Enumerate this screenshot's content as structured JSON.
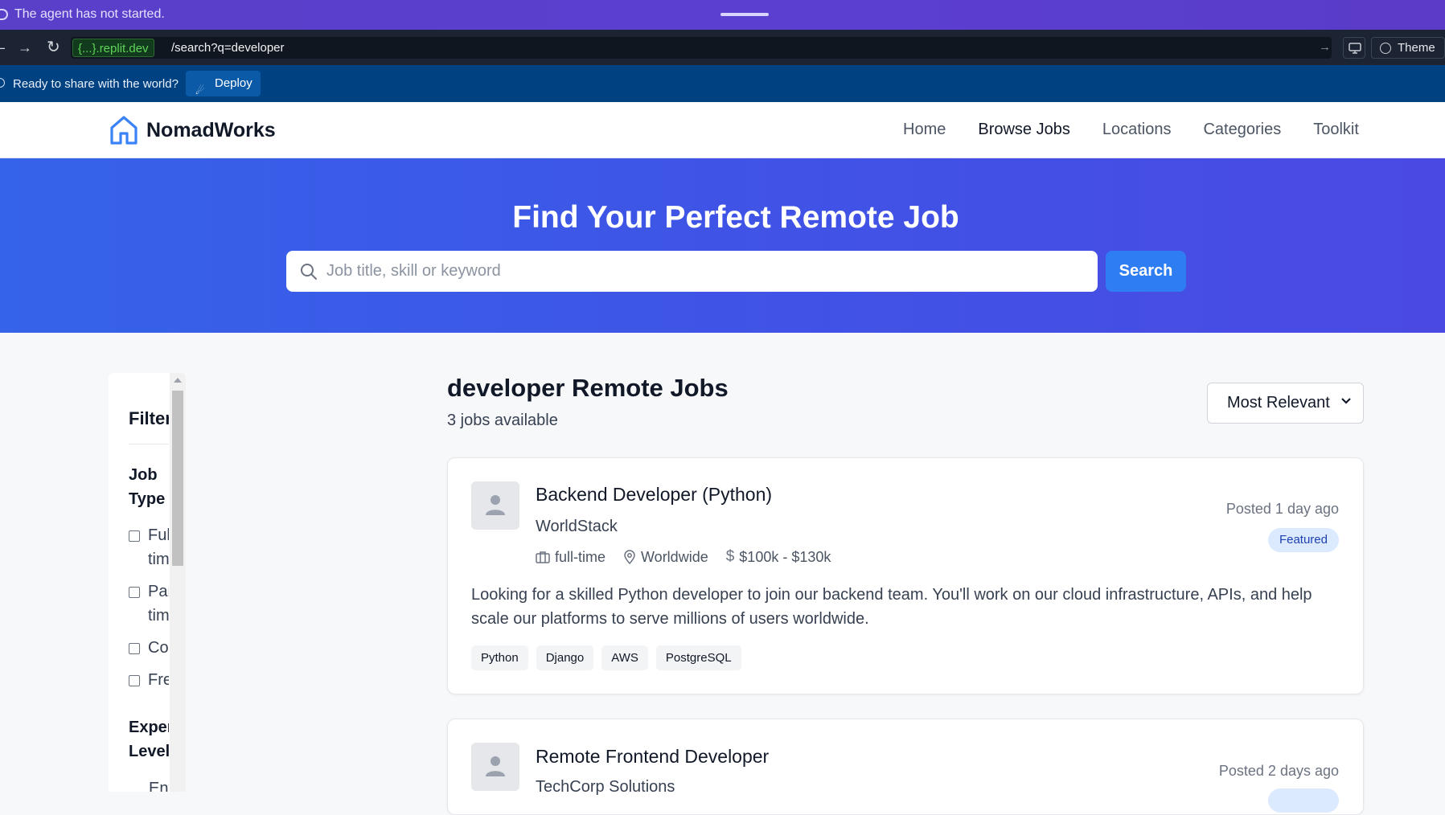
{
  "agent_bar": {
    "status": "The agent has not started."
  },
  "browser": {
    "host": "{...}.replit.dev",
    "path": "/search?q=developer",
    "theme_label": "Theme"
  },
  "deploy_bar": {
    "message": "Ready to share with the world?",
    "deploy_label": "Deploy"
  },
  "header": {
    "brand": "NomadWorks",
    "nav": [
      "Home",
      "Browse Jobs",
      "Locations",
      "Categories",
      "Toolkit"
    ],
    "active_nav": "Browse Jobs"
  },
  "hero": {
    "title": "Find Your Perfect Remote Job",
    "search_placeholder": "Job title, skill or keyword",
    "search_button": "Search"
  },
  "sidebar": {
    "title": "Filters",
    "job_type_label": "Job Type",
    "job_types": [
      "Full time",
      "Part time",
      "Contract",
      "Freelance"
    ],
    "experience_label": "Experience Level",
    "experience_first": "Entry"
  },
  "results": {
    "title": "developer Remote Jobs",
    "count": "3 jobs available",
    "sort_selected": "Most Relevant"
  },
  "jobs": [
    {
      "title": "Backend Developer (Python)",
      "company": "WorldStack",
      "type": "full-time",
      "location": "Worldwide",
      "salary": "$100k - $130k",
      "posted": "Posted 1 day ago",
      "badge": "Featured",
      "description": "Looking for a skilled Python developer to join our backend team. You'll work on our cloud infrastructure, APIs, and help scale our platforms to serve millions of users worldwide.",
      "tags": [
        "Python",
        "Django",
        "AWS",
        "PostgreSQL"
      ]
    },
    {
      "title": "Remote Frontend Developer",
      "company": "TechCorp Solutions",
      "posted": "Posted 2 days ago"
    }
  ],
  "colors": {
    "agent_bar": "#5a3fc9",
    "url_bar": "#1c2433",
    "deploy_bar": "#004182",
    "hero_start": "#3563e9",
    "hero_end": "#4a4ae3",
    "primary_button": "#2f7df3",
    "featured_badge_bg": "#dbeafe"
  },
  "icons": [
    "back-arrow-icon",
    "forward-arrow-icon",
    "reload-icon",
    "go-arrow-icon",
    "screen-icon",
    "palette-icon",
    "deploy-icon",
    "home-logo-icon",
    "search-icon",
    "chevron-down-icon",
    "user-placeholder-icon",
    "briefcase-icon",
    "map-pin-icon",
    "dollar-icon"
  ]
}
